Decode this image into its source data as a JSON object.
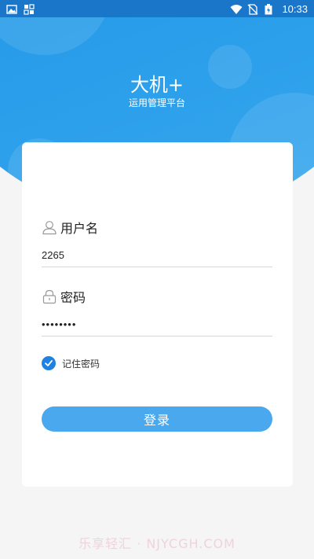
{
  "status_bar": {
    "time": "10:33",
    "left_icons": [
      "image-icon",
      "grid-icon"
    ],
    "right_icons": [
      "wifi-icon",
      "no-sim-icon",
      "battery-icon"
    ]
  },
  "header": {
    "title": "大机+",
    "subtitle": "运用管理平台"
  },
  "form": {
    "username": {
      "label": "用户名",
      "value": "2265",
      "icon": "user-icon"
    },
    "password": {
      "label": "密码",
      "value": "••••••••",
      "icon": "lock-icon"
    },
    "remember": {
      "label": "记住密码",
      "checked": true
    },
    "submit_label": "登录"
  },
  "watermark": "乐享轻汇 · NJYCGH.COM",
  "colors": {
    "primary": "#1a8fe3",
    "button": "#4aa8ef",
    "checkbox": "#1f82e0",
    "background": "#f5f5f5"
  }
}
